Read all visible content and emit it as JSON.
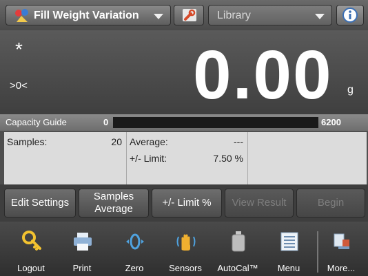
{
  "topbar": {
    "app_title": "Fill Weight Variation",
    "library_label": "Library",
    "app_icon": "app-icon",
    "wrench_icon": "wrench-icon",
    "info_icon": "info-icon"
  },
  "display": {
    "stable_indicator": "*",
    "center_of_zero": ">0<",
    "weight": "0.00",
    "unit": "g"
  },
  "capacity": {
    "label": "Capacity Guide",
    "min": "0",
    "max": "6200",
    "fill_fraction": 0
  },
  "info": {
    "samples_label": "Samples:",
    "samples_value": "20",
    "average_label": "Average:",
    "average_value": "---",
    "limit_label": "+/- Limit:",
    "limit_value": "7.50 %"
  },
  "actions": [
    {
      "label": "Edit Settings",
      "enabled": true
    },
    {
      "label": "Samples Average",
      "enabled": true
    },
    {
      "label": "+/- Limit %",
      "enabled": true
    },
    {
      "label": "View Result",
      "enabled": false
    },
    {
      "label": "Begin",
      "enabled": false
    }
  ],
  "nav": [
    {
      "label": "Logout",
      "icon": "key-icon"
    },
    {
      "label": "Print",
      "icon": "printer-icon"
    },
    {
      "label": "Zero",
      "icon": "zero-icon"
    },
    {
      "label": "Sensors",
      "icon": "hand-sensor-icon"
    },
    {
      "label": "AutoCal™",
      "icon": "calibration-weight-icon"
    },
    {
      "label": "Menu",
      "icon": "menu-list-icon"
    },
    {
      "label": "More...",
      "icon": "more-icon"
    }
  ],
  "colors": {
    "accent_green": "#3da23d",
    "panel": "#dcdcdc"
  }
}
